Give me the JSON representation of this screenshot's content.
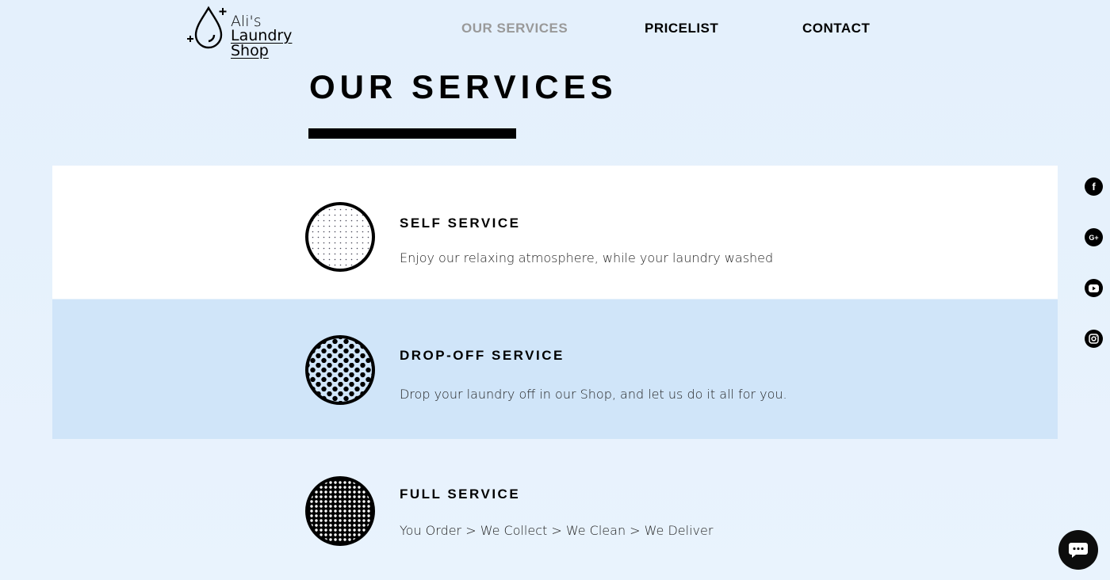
{
  "brand": {
    "line1": "Ali's",
    "line2": "Laundry Shop"
  },
  "nav": [
    {
      "label": "OUR SERVICES",
      "active": true
    },
    {
      "label": "PRICELIST",
      "active": false
    },
    {
      "label": "CONTACT",
      "active": false
    }
  ],
  "page": {
    "title": "OUR SERVICES"
  },
  "services": [
    {
      "title": "SELF SERVICE",
      "description": "Enjoy our relaxing atmosphere, while your laundry washed",
      "icon": "sparse-dot-circle-icon"
    },
    {
      "title": "DROP-OFF SERVICE",
      "description": "Drop your laundry off in our Shop, and let us do it all for you.",
      "icon": "polka-dot-circle-icon"
    },
    {
      "title": "FULL SERVICE",
      "description": "You Order > We Collect > We Clean > We Deliver",
      "icon": "dense-dot-circle-icon"
    }
  ],
  "social": [
    "facebook-icon",
    "google-plus-icon",
    "youtube-icon",
    "instagram-icon"
  ],
  "colors": {
    "background": "#e6f1fc",
    "band_highlight": "#d0e5f9",
    "nav_active": "#999999",
    "text": "#000000"
  }
}
